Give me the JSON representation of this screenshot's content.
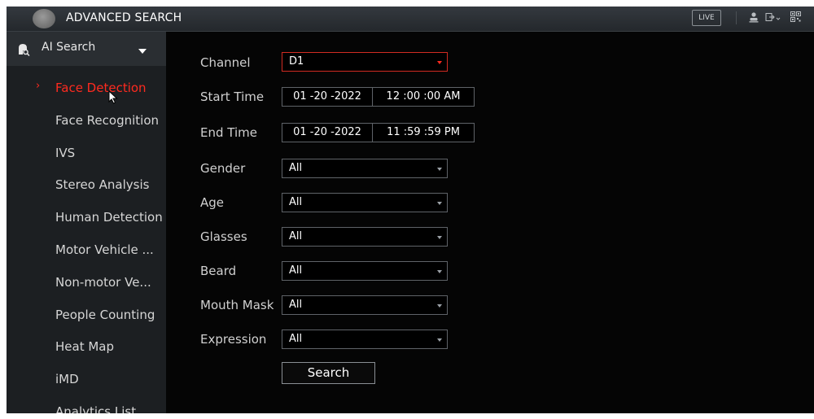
{
  "header": {
    "title": "ADVANCED SEARCH",
    "live_label": "LIVE",
    "icons": [
      "user-icon",
      "logout-icon",
      "qr-code-icon"
    ]
  },
  "sidebar": {
    "section_label": "AI Search",
    "items": [
      {
        "label": "Face Detection",
        "active": true
      },
      {
        "label": "Face Recognition",
        "active": false
      },
      {
        "label": "IVS",
        "active": false
      },
      {
        "label": "Stereo Analysis",
        "active": false
      },
      {
        "label": "Human Detection",
        "active": false
      },
      {
        "label": "Motor Vehicle ...",
        "active": false
      },
      {
        "label": "Non-motor Ve...",
        "active": false
      },
      {
        "label": "People Counting",
        "active": false
      },
      {
        "label": "Heat Map",
        "active": false
      },
      {
        "label": "iMD",
        "active": false
      },
      {
        "label": "Analytics List",
        "active": false
      }
    ]
  },
  "form": {
    "channel": {
      "label": "Channel",
      "value": "D1"
    },
    "start_time": {
      "label": "Start Time",
      "date": "01 -20 -2022",
      "time": "12 :00 :00 AM"
    },
    "end_time": {
      "label": "End Time",
      "date": "01 -20 -2022",
      "time": "11 :59 :59 PM"
    },
    "gender": {
      "label": "Gender",
      "value": "All"
    },
    "age": {
      "label": "Age",
      "value": "All"
    },
    "glasses": {
      "label": "Glasses",
      "value": "All"
    },
    "beard": {
      "label": "Beard",
      "value": "All"
    },
    "mouth_mask": {
      "label": "Mouth Mask",
      "value": "All"
    },
    "expression": {
      "label": "Expression",
      "value": "All"
    },
    "search_label": "Search"
  },
  "colors": {
    "accent": "#ff2a1f",
    "background": "#050505",
    "sidebar": "#1c1f22"
  }
}
